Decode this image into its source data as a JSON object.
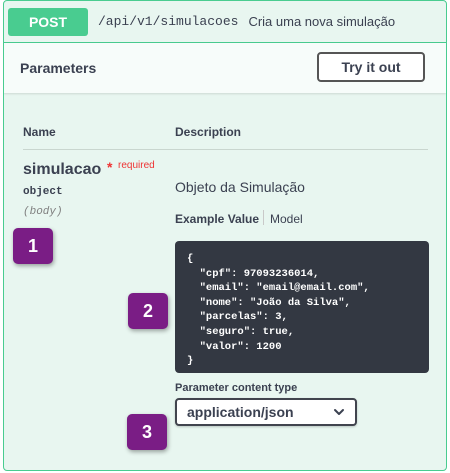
{
  "operation": {
    "method": "POST",
    "path": "/api/v1/simulacoes",
    "summary": "Cria uma nova simulação"
  },
  "parameters_section": {
    "title": "Parameters",
    "try_label": "Try it out"
  },
  "table": {
    "name_header": "Name",
    "description_header": "Description"
  },
  "param": {
    "name": "simulacao",
    "required_star": "*",
    "required_label": "required",
    "type": "object",
    "location": "(body)",
    "description": "Objeto da Simulação",
    "example_tab": "Example Value",
    "model_tab": "Model",
    "example_json": "{\n  \"cpf\": 97093236014,\n  \"email\": \"email@email.com\",\n  \"nome\": \"João da Silva\",\n  \"parcelas\": 3,\n  \"seguro\": true,\n  \"valor\": 1200\n}",
    "content_type_label": "Parameter content type",
    "content_type_value": "application/json"
  },
  "badges": [
    "1",
    "2",
    "3"
  ],
  "colors": {
    "post_green": "#49cc90",
    "block_bg": "#e8f6f0",
    "badge_purple": "#7a1d85",
    "code_bg": "#333842"
  },
  "icons": {
    "select_arrow": "chevron-down-icon"
  }
}
